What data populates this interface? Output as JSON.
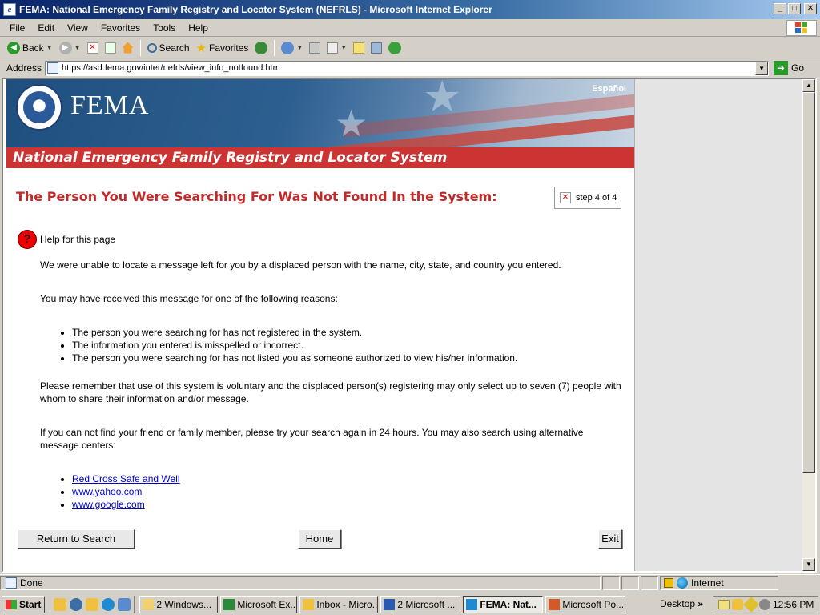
{
  "window": {
    "title": "FEMA: National Emergency Family Registry and Locator System (NEFRLS) - Microsoft Internet Explorer",
    "min": "_",
    "max": "□",
    "close": "✕"
  },
  "menu": [
    "File",
    "Edit",
    "View",
    "Favorites",
    "Tools",
    "Help"
  ],
  "toolbar": {
    "back": "Back",
    "search": "Search",
    "favorites": "Favorites"
  },
  "address": {
    "label": "Address",
    "url": "https://asd.fema.gov/inter/nefrls/view_info_notfound.htm",
    "go": "Go"
  },
  "banner": {
    "logo_text": "FEMA",
    "language_link": "Español",
    "subtitle": "National Emergency Family Registry and Locator System"
  },
  "page": {
    "heading": "The Person You Were Searching For Was Not Found In the System:",
    "step": "step 4 of 4",
    "help": "Help for this page",
    "para1": "We were unable to locate a message left for you by a displaced person with the name, city, state, and country you entered.",
    "para2": "You may have received this message for one of the following reasons:",
    "reasons": [
      "The person you were searching for has not registered in the system.",
      "The information you entered is misspelled or incorrect.",
      "The person you were searching for has not listed you as someone authorized to view his/her information."
    ],
    "para3": "Please remember that use of this system is voluntary and the displaced person(s) registering may only select up to seven (7) people with whom to share their information and/or message.",
    "para4": "If you can not find your friend or family member, please try your search again in 24 hours. You may also search using alternative message centers:",
    "links": [
      "Red Cross Safe and Well",
      "www.yahoo.com",
      "www.google.com"
    ],
    "buttons": {
      "return": "Return to Search",
      "home": "Home",
      "exit": "Exit"
    }
  },
  "status": {
    "text": "Done",
    "zone": "Internet"
  },
  "taskbar": {
    "start": "Start",
    "tasks": [
      "2 Windows...",
      "Microsoft Ex...",
      "Inbox - Micro...",
      "2 Microsoft ...",
      "FEMA: Nat...",
      "Microsoft Po..."
    ],
    "desktop": "Desktop",
    "clock": "12:56 PM"
  },
  "colors": {
    "title_red": "#c22a2a",
    "subtitle_bar": "#cc3333",
    "link": "#0000cc"
  }
}
